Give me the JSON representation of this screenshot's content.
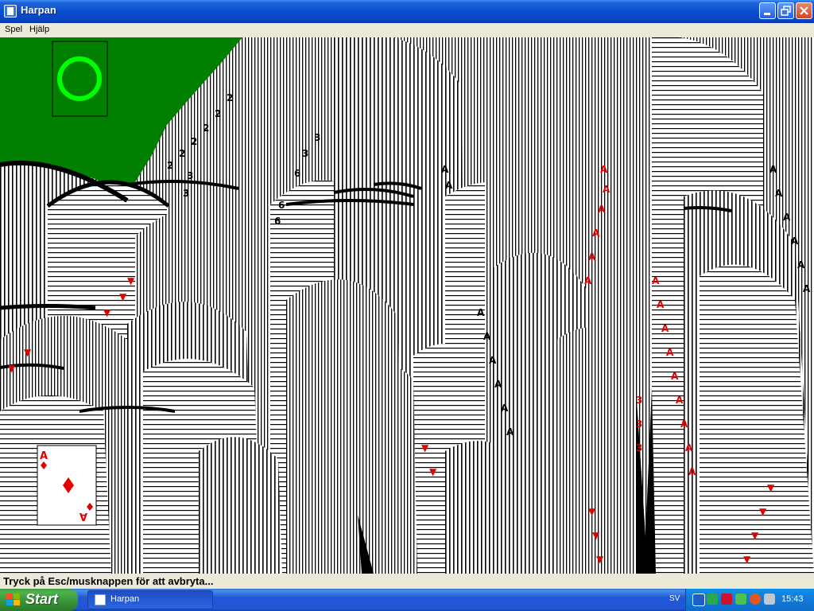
{
  "window": {
    "title": "Harpan"
  },
  "menu": [
    {
      "label": "Spel"
    },
    {
      "label": "Hjälp"
    }
  ],
  "status": {
    "text": "Tryck på Esc/musknappen för att avbryta..."
  },
  "taskbar": {
    "start_label": "Start",
    "task_label": "Harpan",
    "language": "SV",
    "clock": "15:43"
  },
  "game": {
    "felt_color": "#007f00",
    "ring_color": "#00ff00",
    "card_front_ranks": [
      "A",
      "2",
      "3"
    ],
    "card_front_suit": "diamond",
    "card_back_pattern": "vertical-stripes"
  },
  "tray_icons": [
    "back-arrow-icon",
    "messenger-icon",
    "adobe-icon",
    "network-icon",
    "security-icon",
    "volume-icon"
  ]
}
